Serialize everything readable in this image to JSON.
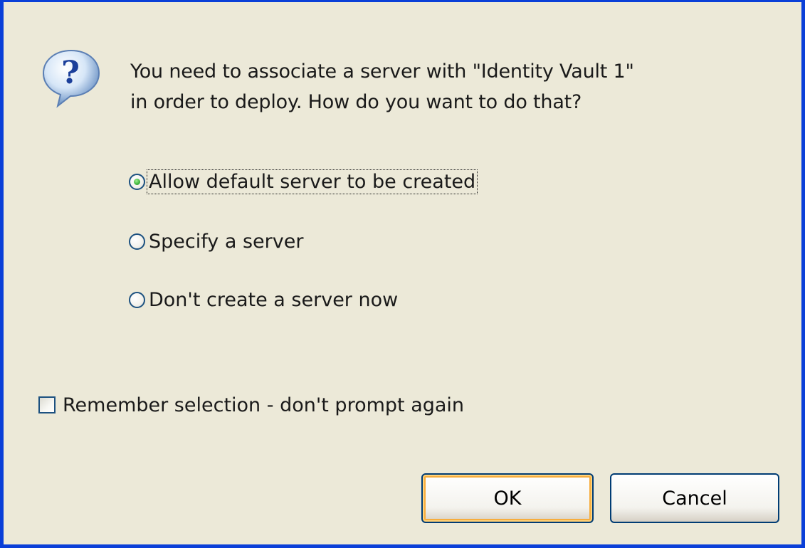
{
  "dialog": {
    "message_lines": [
      "You need to associate a server with \"Identity Vault 1\"",
      "in order to deploy.  How do you want to do that?"
    ],
    "icon": "question-icon",
    "options": [
      {
        "label": "Allow default server to be created",
        "selected": true
      },
      {
        "label": "Specify a server",
        "selected": false
      },
      {
        "label": "Don't create a server now",
        "selected": false
      }
    ],
    "remember": {
      "label": "Remember selection - don't prompt again",
      "checked": false
    },
    "buttons": {
      "ok": "OK",
      "cancel": "Cancel"
    }
  },
  "colors": {
    "background": "#ece9d8",
    "border": "#0a3fd8",
    "radio_selected": "#3bb33a"
  }
}
